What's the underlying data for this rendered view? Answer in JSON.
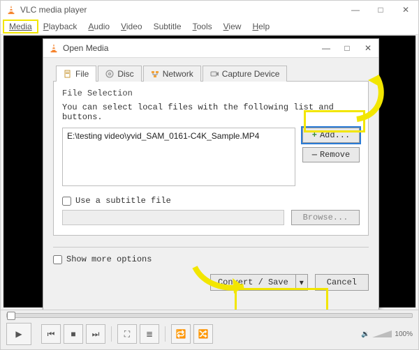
{
  "app": {
    "title": "VLC media player"
  },
  "menu": {
    "media": "Media",
    "playback": "Playback",
    "audio": "Audio",
    "video": "Video",
    "subtitle": "Subtitle",
    "tools": "Tools",
    "view": "View",
    "help": "Help"
  },
  "dialog": {
    "title": "Open Media",
    "tabs": {
      "file": "File",
      "disc": "Disc",
      "network": "Network",
      "capture": "Capture Device"
    },
    "file_selection_label": "File Selection",
    "hint": "You can select local files with the following list and buttons.",
    "file_entry": "E:\\testing video\\yvid_SAM_0161-C4K_Sample.MP4",
    "add": "Add...",
    "remove": "Remove",
    "use_subtitle": "Use a subtitle file",
    "browse": "Browse...",
    "show_more": "Show more options",
    "convert_save": "Convert / Save",
    "cancel": "Cancel"
  },
  "player": {
    "volume_pct": "100%"
  },
  "glyph": {
    "min": "—",
    "max": "□",
    "close": "✕",
    "plus": "+",
    "minus": "—",
    "dd": "▾",
    "play": "▶",
    "prev": "⏮",
    "stop": "■",
    "next": "⏭",
    "fullscreen": "⛶",
    "ext": "≣",
    "loop": "🔁",
    "shuffle": "🔀",
    "speaker": "🔉"
  }
}
